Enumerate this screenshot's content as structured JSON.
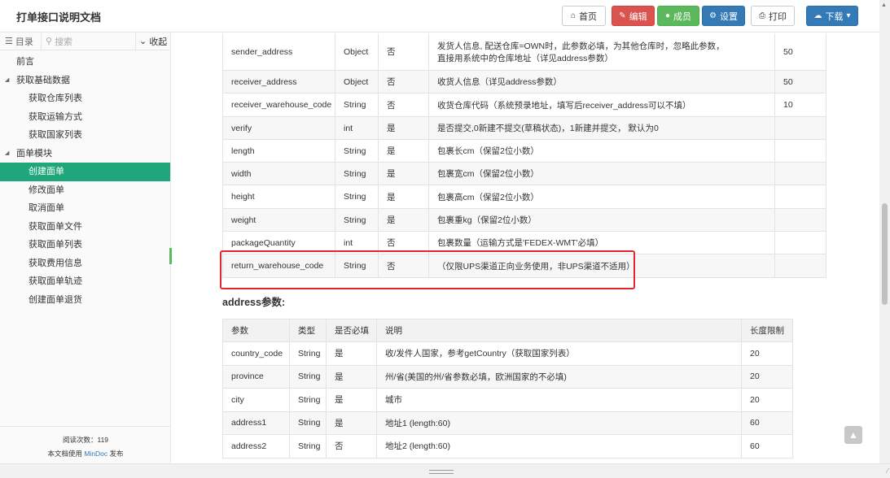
{
  "header": {
    "title": "打单接口说明文档",
    "buttons": {
      "home": "首页",
      "edit": "编辑",
      "members": "成员",
      "settings": "设置",
      "print": "打印",
      "download": "下载"
    }
  },
  "sidebar": {
    "toc_label": "目录",
    "search_placeholder": "搜索",
    "collapse_label": "收起",
    "items": [
      {
        "label": "前言"
      },
      {
        "label": "获取基础数据"
      },
      {
        "label": "获取仓库列表"
      },
      {
        "label": "获取运输方式"
      },
      {
        "label": "获取国家列表"
      },
      {
        "label": "面单模块"
      },
      {
        "label": "创建面单"
      },
      {
        "label": "修改面单"
      },
      {
        "label": "取消面单"
      },
      {
        "label": "获取面单文件"
      },
      {
        "label": "获取面单列表"
      },
      {
        "label": "获取费用信息"
      },
      {
        "label": "获取面单轨迹"
      },
      {
        "label": "创建面单退货"
      }
    ],
    "footer": {
      "reads": "阅读次数：119",
      "powered_pre": "本文档使用 ",
      "powered_link": "MinDoc",
      "powered_post": " 发布"
    }
  },
  "table1": {
    "rows": [
      {
        "param": "sender_address",
        "type": "Object",
        "required": "否",
        "desc": "发货人信息, 配送仓库=OWN时，此参数必填，为其他仓库时，忽略此参数，",
        "desc2": "直接用系统中的仓库地址（详见address参数）",
        "len": "50"
      },
      {
        "param": "receiver_address",
        "type": "Object",
        "required": "否",
        "desc": "收货人信息（详见address参数）",
        "desc2": "",
        "len": "50"
      },
      {
        "param": "receiver_warehouse_code",
        "type": "String",
        "required": "否",
        "desc": "收货仓库代码（系统预录地址，填写后receiver_address可以不填）",
        "desc2": "",
        "len": "10"
      },
      {
        "param": "verify",
        "type": "int",
        "required": "是",
        "desc": "是否提交,0新建不提交(草稿状态)，1新建并提交， 默认为0",
        "desc2": "",
        "len": ""
      },
      {
        "param": "length",
        "type": "String",
        "required": "是",
        "desc": "包裹长cm（保留2位小数）",
        "desc2": "",
        "len": ""
      },
      {
        "param": "width",
        "type": "String",
        "required": "是",
        "desc": "包裹宽cm（保留2位小数）",
        "desc2": "",
        "len": ""
      },
      {
        "param": "height",
        "type": "String",
        "required": "是",
        "desc": "包裹高cm（保留2位小数）",
        "desc2": "",
        "len": ""
      },
      {
        "param": "weight",
        "type": "String",
        "required": "是",
        "desc": "包裹重kg（保留2位小数）",
        "desc2": "",
        "len": ""
      },
      {
        "param": "packageQuantity",
        "type": "int",
        "required": "否",
        "desc": "包裹数量（运输方式是'FEDEX-WMT'必填）",
        "desc2": "",
        "len": ""
      },
      {
        "param": "return_warehouse_code",
        "type": "String",
        "required": "否",
        "desc": "（仅限UPS渠道正向业务使用，非UPS渠道不适用）",
        "desc2": "",
        "len": ""
      }
    ]
  },
  "address_section": {
    "title": "address参数:",
    "headers": {
      "param": "参数",
      "type": "类型",
      "required": "是否必填",
      "desc": "说明",
      "len": "长度限制"
    },
    "rows": [
      {
        "param": "country_code",
        "type": "String",
        "required": "是",
        "desc": "收/发件人国家，参考getCountry（获取国家列表）",
        "len": "20"
      },
      {
        "param": "province",
        "type": "String",
        "required": "是",
        "desc": "州/省(美国的州/省参数必填，欧洲国家的不必填)",
        "len": "20"
      },
      {
        "param": "city",
        "type": "String",
        "required": "是",
        "desc": "城市",
        "len": "20"
      },
      {
        "param": "address1",
        "type": "String",
        "required": "是",
        "desc": "地址1 (length:60)",
        "len": "60"
      },
      {
        "param": "address2",
        "type": "String",
        "required": "否",
        "desc": "地址2 (length:60)",
        "len": "60"
      }
    ]
  }
}
